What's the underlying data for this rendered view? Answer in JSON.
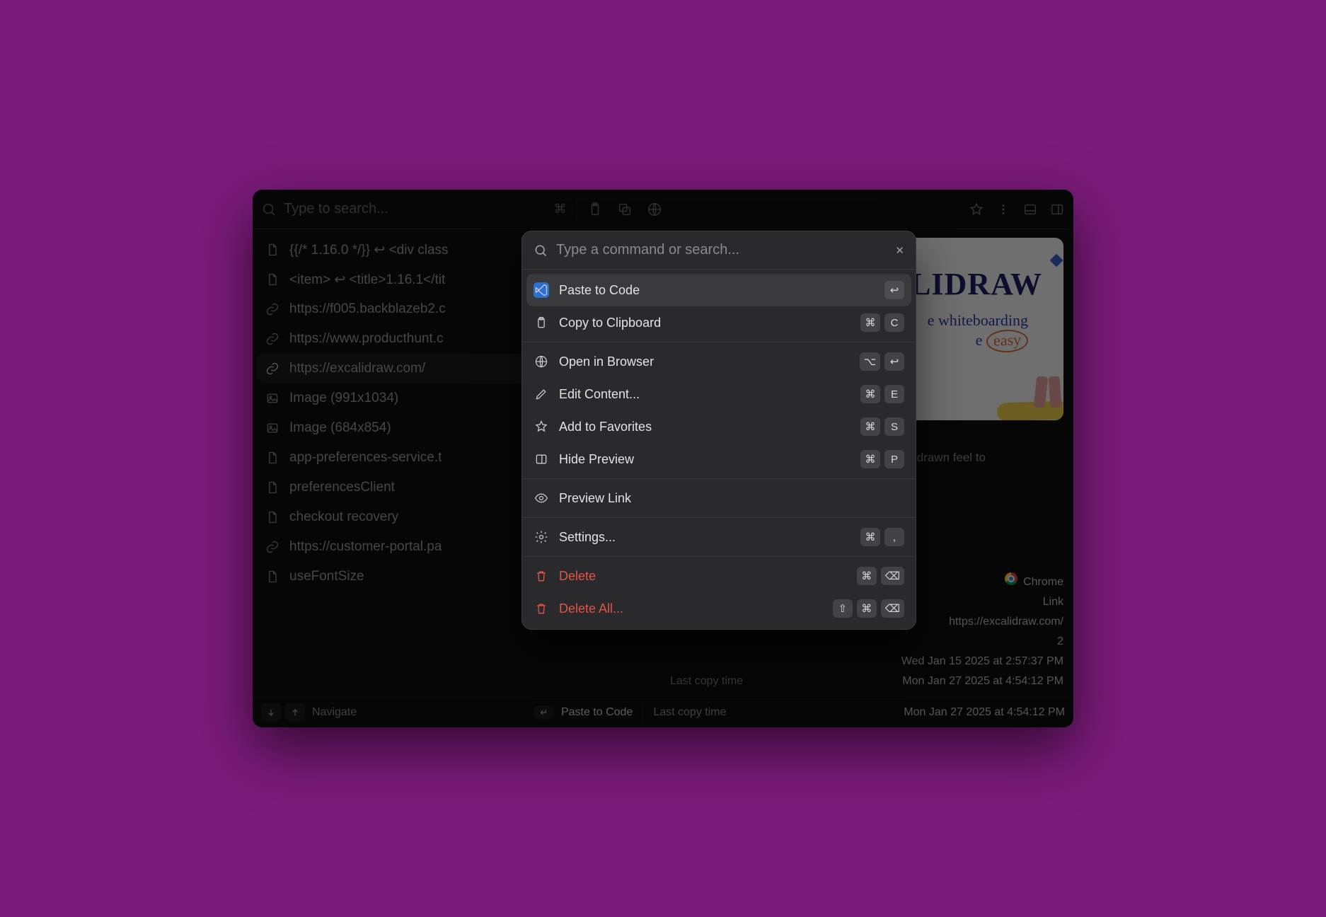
{
  "topbar": {
    "search_placeholder": "Type to search...",
    "shortcut_symbol": "⌘"
  },
  "sidebar": {
    "items": [
      {
        "icon": "file",
        "label": "{{/* 1.16.0 */}}  ↩  <div class"
      },
      {
        "icon": "file",
        "label": "<item>  ↩  <title>1.16.1</tit"
      },
      {
        "icon": "link",
        "label": "https://f005.backblazeb2.c"
      },
      {
        "icon": "link",
        "label": "https://www.producthunt.c"
      },
      {
        "icon": "link",
        "label": "https://excalidraw.com/",
        "selected": true
      },
      {
        "icon": "image",
        "label": "Image (991x1034)"
      },
      {
        "icon": "image",
        "label": "Image (684x854)"
      },
      {
        "icon": "file",
        "label": "app-preferences-service.t"
      },
      {
        "icon": "file",
        "label": "preferencesClient"
      },
      {
        "icon": "file",
        "label": "checkout recovery"
      },
      {
        "icon": "link",
        "label": "https://customer-portal.pa"
      },
      {
        "icon": "file",
        "label": "useFontSize"
      }
    ]
  },
  "preview": {
    "brand": "ALIDRAW",
    "tagline_prefix": "e whiteboarding",
    "tagline_easy": "easy",
    "title": "whiteboarding made easy",
    "description": "rative whiteboard tool that lets at have a hand-drawn feel to",
    "meta": [
      {
        "label": "",
        "value": "Chrome",
        "icon": "chrome"
      },
      {
        "label": "",
        "value": "Link"
      },
      {
        "label": "",
        "value": "https://excalidraw.com/"
      },
      {
        "label": "",
        "value": "2"
      },
      {
        "label": "",
        "value": "Wed Jan 15 2025 at 2:57:37 PM"
      },
      {
        "label": "Last copy time",
        "value": "Mon Jan 27 2025 at 4:54:12 PM"
      }
    ]
  },
  "statusbar": {
    "navigate": "Navigate",
    "primary_action": "Paste to Code",
    "last_copy_label": "Last copy time"
  },
  "palette": {
    "placeholder": "Type a command or search...",
    "groups": [
      [
        {
          "icon": "vscode",
          "label": "Paste to Code",
          "keys": [
            "↩"
          ],
          "hl": true
        },
        {
          "icon": "clipboard",
          "label": "Copy to Clipboard",
          "keys": [
            "⌘",
            "C"
          ]
        }
      ],
      [
        {
          "icon": "globe",
          "label": "Open in Browser",
          "keys": [
            "⌥",
            "↩"
          ]
        },
        {
          "icon": "pencil",
          "label": "Edit Content...",
          "keys": [
            "⌘",
            "E"
          ]
        },
        {
          "icon": "star",
          "label": "Add to Favorites",
          "keys": [
            "⌘",
            "S"
          ]
        },
        {
          "icon": "sidebar",
          "label": "Hide Preview",
          "keys": [
            "⌘",
            "P"
          ]
        }
      ],
      [
        {
          "icon": "eye",
          "label": "Preview Link",
          "keys": []
        }
      ],
      [
        {
          "icon": "gear",
          "label": "Settings...",
          "keys": [
            "⌘",
            ","
          ]
        }
      ],
      [
        {
          "icon": "trash",
          "label": "Delete",
          "keys": [
            "⌘",
            "⌫"
          ],
          "danger": true
        },
        {
          "icon": "trash",
          "label": "Delete All...",
          "keys": [
            "⇧",
            "⌘",
            "⌫"
          ],
          "danger": true
        }
      ]
    ]
  }
}
